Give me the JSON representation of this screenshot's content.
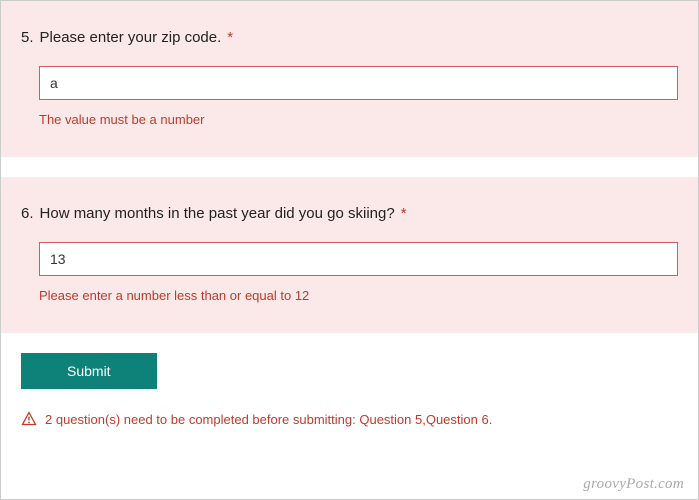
{
  "questions": [
    {
      "number": "5.",
      "text": "Please enter your zip code.",
      "required_marker": "*",
      "input_value": "a",
      "error": "The value must be a number"
    },
    {
      "number": "6.",
      "text": "How many months in the past year did you go skiing?",
      "required_marker": "*",
      "input_value": "13",
      "error": "Please enter a number less than or equal to 12"
    }
  ],
  "submit_label": "Submit",
  "global_error": "2 question(s) need to be completed before submitting: Question 5,Question 6.",
  "watermark": "groovyPost.com"
}
